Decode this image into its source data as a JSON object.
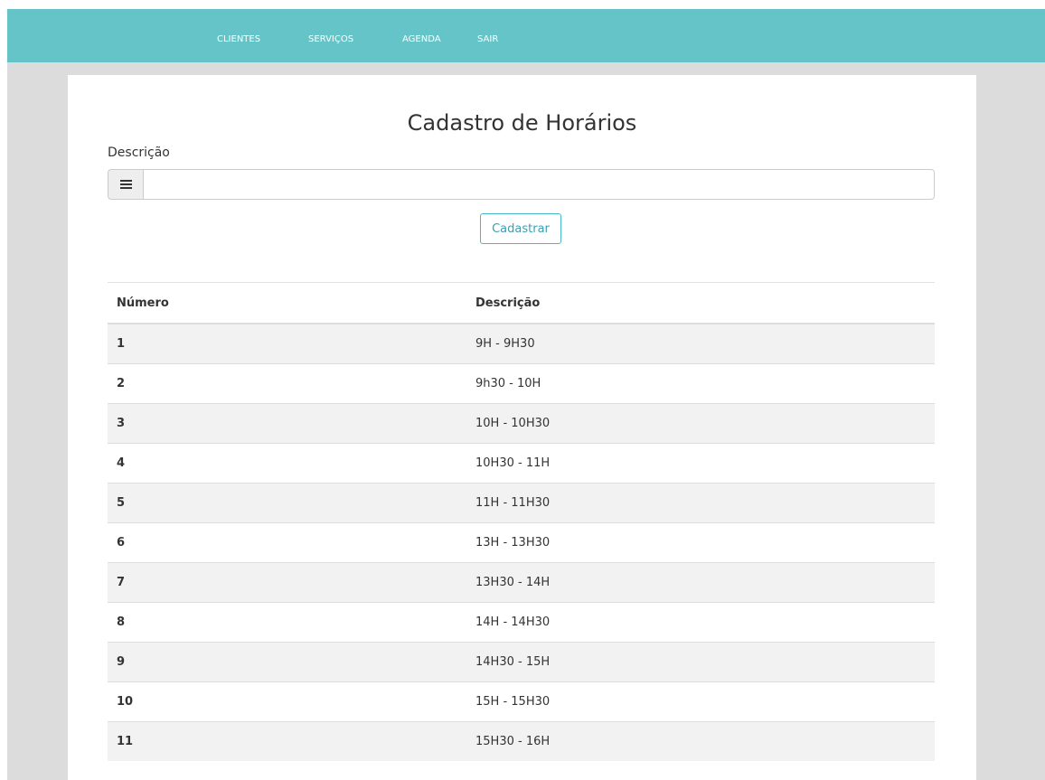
{
  "nav": {
    "items": [
      {
        "label": "CLIENTES"
      },
      {
        "label": "SERVIÇOS"
      },
      {
        "label": "AGENDA"
      },
      {
        "label": "SAIR"
      }
    ]
  },
  "form": {
    "title": "Cadastro de Horários",
    "description_label": "Descrição",
    "description_value": "",
    "description_icon": "list-icon",
    "submit_label": "Cadastrar"
  },
  "table": {
    "headers": [
      "Número",
      "Descrição"
    ],
    "rows": [
      {
        "number": "1",
        "description": "9H - 9H30"
      },
      {
        "number": "2",
        "description": "9h30 - 10H"
      },
      {
        "number": "3",
        "description": "10H - 10H30"
      },
      {
        "number": "4",
        "description": "10H30 - 11H"
      },
      {
        "number": "5",
        "description": "11H - 11H30"
      },
      {
        "number": "6",
        "description": "13H - 13H30"
      },
      {
        "number": "7",
        "description": "13H30 - 14H"
      },
      {
        "number": "8",
        "description": "14H - 14H30"
      },
      {
        "number": "9",
        "description": "14H30 - 15H"
      },
      {
        "number": "10",
        "description": "15H - 15H30"
      },
      {
        "number": "11",
        "description": "15H30 - 16H"
      }
    ]
  },
  "colors": {
    "navbar": "#64c4c7",
    "background": "#dcdcdc",
    "button_border": "#46b8c8",
    "striped_row": "#f2f2f2"
  }
}
